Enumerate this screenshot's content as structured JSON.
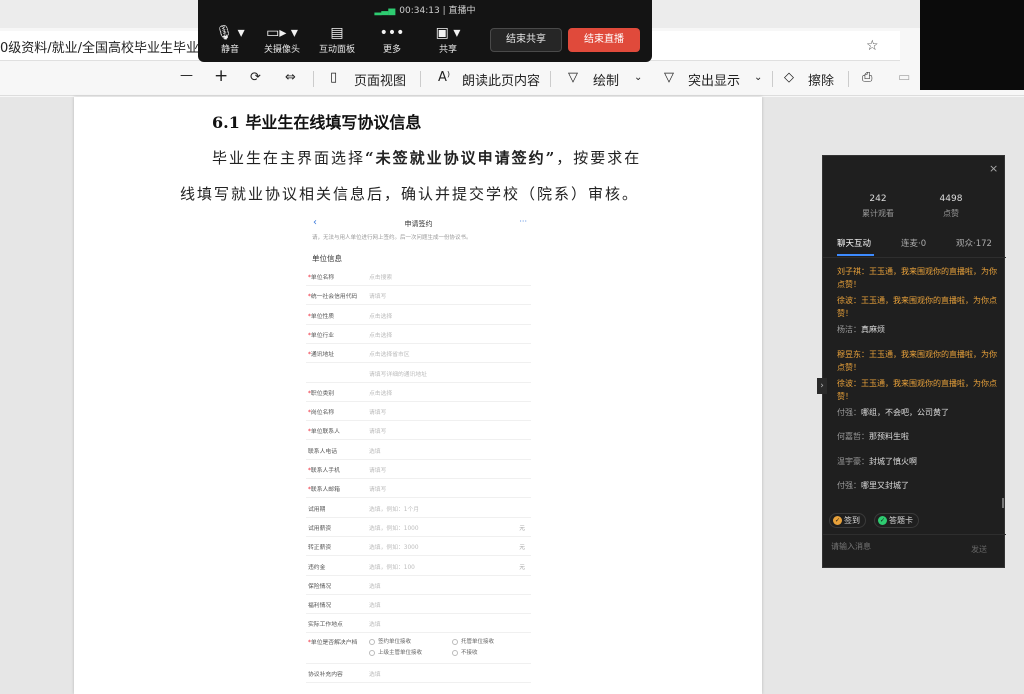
{
  "browser": {
    "address_text": "0级资料/就业/全国高校毕业生毕业去",
    "toolbar": {
      "minus": "—",
      "plus": "+",
      "page_view": "页面视图",
      "read_aloud": "朗读此页内容",
      "draw": "绘制",
      "highlight": "突出显示",
      "erase": "擦除"
    }
  },
  "meeting": {
    "timer": "00:34:13",
    "status": "直播中",
    "buttons": [
      {
        "label": "静音",
        "icon": "mic-icon"
      },
      {
        "label": "关摄像头",
        "icon": "camera-icon"
      },
      {
        "label": "互动面板",
        "icon": "interactive-panel-icon"
      },
      {
        "label": "更多",
        "icon": "more-icon"
      },
      {
        "label": "共享",
        "icon": "share-screen-icon"
      }
    ],
    "end_share": "结束共享",
    "end_live": "结束直播"
  },
  "document": {
    "heading": "6.1 毕业生在线填写协议信息",
    "para1_pre": "毕业生在主界面选择",
    "para1_bold": "“未签就业协议申请签约”",
    "para1_post": "，按要求在",
    "para2": "线填写就业协议相关信息后，确认并提交学校（院系）审核。",
    "phone": {
      "title": "申请签约",
      "back": "‹",
      "more": "···",
      "note": "请，无法与用人单位进行网上签约。后一次问题生成一份协议书。",
      "section": "单位信息",
      "fields": [
        {
          "label": "单位名称",
          "required": "*",
          "value": "点击搜索",
          "unit": ""
        },
        {
          "label": "统一社会信用代码",
          "required": "*",
          "value": "请填写",
          "unit": ""
        },
        {
          "label": "单位性质",
          "required": "*",
          "value": "点击选择",
          "unit": ""
        },
        {
          "label": "单位行业",
          "required": "*",
          "value": "点击选择",
          "unit": ""
        },
        {
          "label": "通讯地址",
          "required": "*",
          "value": "点击选择省市区",
          "unit": ""
        },
        {
          "label": "",
          "required": "",
          "value": "请填写详细的通讯地址",
          "unit": ""
        },
        {
          "label": "职位类别",
          "required": "*",
          "value": "点击选择",
          "unit": ""
        },
        {
          "label": "岗位名称",
          "required": "*",
          "value": "请填写",
          "unit": ""
        },
        {
          "label": "单位联系人",
          "required": "*",
          "value": "请填写",
          "unit": ""
        },
        {
          "label": "联系人电话",
          "required": "",
          "value": "选填",
          "unit": ""
        },
        {
          "label": "联系人手机",
          "required": "*",
          "value": "请填写",
          "unit": ""
        },
        {
          "label": "联系人邮箱",
          "required": "*",
          "value": "请填写",
          "unit": ""
        },
        {
          "label": "试用期",
          "required": "",
          "value": "选填，例如：1个月",
          "unit": ""
        },
        {
          "label": "试用薪资",
          "required": "",
          "value": "选填，例如：1000",
          "unit": "元"
        },
        {
          "label": "转正薪资",
          "required": "",
          "value": "选填，例如：3000",
          "unit": "元"
        },
        {
          "label": "违约金",
          "required": "",
          "value": "选填，例如：100",
          "unit": "元"
        },
        {
          "label": "保险情况",
          "required": "",
          "value": "选填",
          "unit": ""
        },
        {
          "label": "福利情况",
          "required": "",
          "value": "选填",
          "unit": ""
        },
        {
          "label": "实际工作地点",
          "required": "",
          "value": "选填",
          "unit": ""
        }
      ],
      "decision_label": "单位是否解决户档",
      "decision_options": [
        "签约单位接收",
        "托管单位接收",
        "上级主管单位接收",
        "不接收"
      ],
      "last_field": {
        "label": "协议补充内容",
        "value": "选填"
      }
    }
  },
  "live": {
    "close": "×",
    "viewers": "242",
    "viewers_label": "累计观看",
    "likes": "4498",
    "likes_label": "点赞",
    "tabs": [
      "聊天互动",
      "连麦·0",
      "观众·172"
    ],
    "side_arrow": "›",
    "messages": [
      {
        "name": "刘子祺：",
        "text": "王玉通，我来围观你的直播啦，为你点赞！",
        "highlight": true
      },
      {
        "name": "徐波：",
        "text": "王玉通，我来围观你的直播啦，为你点赞！",
        "highlight": true
      },
      {
        "name": "杨洁：",
        "text": "真麻烦",
        "highlight": false
      },
      {
        "name": "穆昱东：",
        "text": "王玉通，我来围观你的直播啦，为你点赞！",
        "highlight": true
      },
      {
        "name": "徐波：",
        "text": "王玉通，我来围观你的直播啦，为你点赞！",
        "highlight": true
      },
      {
        "name": "付强：",
        "text": "哪组，不会吧，公司黄了",
        "highlight": false
      },
      {
        "name": "何嘉哲：",
        "text": "那预料生啦",
        "highlight": false
      },
      {
        "name": "温宇豪：",
        "text": "封城了慎火啊",
        "highlight": false
      },
      {
        "name": "付强：",
        "text": "哪里又封城了",
        "highlight": false
      }
    ],
    "chip_signin": "签到",
    "chip_answer": "答题卡",
    "input_placeholder": "请输入消息",
    "send": "发送"
  }
}
